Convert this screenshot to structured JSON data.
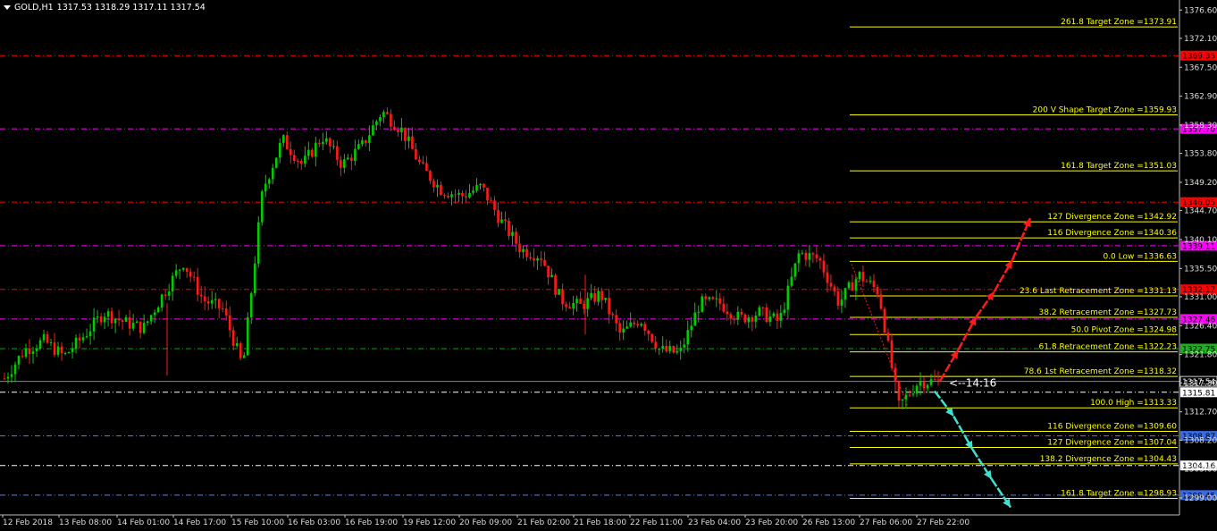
{
  "header": {
    "symbol": "GOLD,H1",
    "ohlc": "1317.53 1318.29 1317.11 1317.54"
  },
  "countdown": "<--14:16",
  "colors": {
    "background": "#000000",
    "bull": "#00cc00",
    "bear": "#ff1a1a",
    "fib": "#ffff00",
    "red_level": "#ff0000",
    "magenta_level": "#ff00ff",
    "green_level": "#00aa00",
    "blue_level": "#4a7fff",
    "white_level": "#ffffff",
    "cyan_arrow": "#40e0d0",
    "red_arrow": "#ff1a1a"
  },
  "chart_data": {
    "type": "candlestick",
    "ylim": [
      1296.3,
      1378.2
    ],
    "y_ticks": [
      "1376.60",
      "1372.10",
      "1367.50",
      "1362.90",
      "1358.30",
      "1353.80",
      "1349.20",
      "1344.70",
      "1340.10",
      "1335.50",
      "1331.00",
      "1326.40",
      "1321.80",
      "1317.30",
      "1312.70",
      "1308.20",
      "1303.60",
      "1299.00"
    ],
    "x_ticks": [
      "12 Feb 2018",
      "13 Feb 08:00",
      "14 Feb 01:00",
      "14 Feb 17:00",
      "15 Feb 10:00",
      "16 Feb 03:00",
      "16 Feb 19:00",
      "19 Feb 12:00",
      "20 Feb 09:00",
      "21 Feb 02:00",
      "21 Feb 18:00",
      "22 Feb 11:00",
      "23 Feb 04:00",
      "23 Feb 20:00",
      "26 Feb 13:00",
      "27 Feb 06:00",
      "27 Feb 22:00"
    ],
    "price_path": [
      1318.0,
      1322.5,
      1324.0,
      1321.5,
      1324.8,
      1328.5,
      1327.0,
      1326.0,
      1331.5,
      1336.5,
      1330.5,
      1329.0,
      1319.8,
      1348.0,
      1356.0,
      1352.0,
      1356.5,
      1352.0,
      1355.0,
      1360.5,
      1357.5,
      1351.5,
      1348.0,
      1347.0,
      1348.5,
      1343.0,
      1338.5,
      1337.5,
      1330.5,
      1329.5,
      1331.5,
      1325.0,
      1327.5,
      1322.5,
      1322.0,
      1330.0,
      1330.0,
      1327.5,
      1328.5,
      1327.0,
      1338.0,
      1337.0,
      1330.0,
      1334.5,
      1331.8,
      1313.5,
      1317.5,
      1317.54
    ],
    "current_price": 1317.54,
    "horizontal_levels": [
      {
        "price": 1369.35,
        "style": "red",
        "label": "1369.35"
      },
      {
        "price": 1357.7,
        "style": "magenta",
        "label": "1357.70"
      },
      {
        "price": 1346.05,
        "style": "red",
        "label": "1346.05"
      },
      {
        "price": 1339.11,
        "style": "magenta",
        "label": "1339.11"
      },
      {
        "price": 1332.17,
        "style": "red",
        "label": "1332.17"
      },
      {
        "price": 1327.46,
        "style": "magenta",
        "label": "1327.46"
      },
      {
        "price": 1322.75,
        "style": "green",
        "label": "1322.75"
      },
      {
        "price": 1315.81,
        "style": "white",
        "label": "1315.81"
      },
      {
        "price": 1308.87,
        "style": "blue",
        "label": "1308.87"
      },
      {
        "price": 1304.16,
        "style": "white",
        "label": "1304.16"
      },
      {
        "price": 1299.45,
        "style": "blue",
        "label": "1299.45"
      }
    ],
    "fib_levels": [
      {
        "price": 1373.91,
        "label": "261.8 Target Zone =1373.91"
      },
      {
        "price": 1359.93,
        "label": "200  V Shape Target Zone =1359.93"
      },
      {
        "price": 1351.03,
        "label": "161.8 Target Zone =1351.03"
      },
      {
        "price": 1342.92,
        "label": "127 Divergence Zone =1342.92"
      },
      {
        "price": 1340.36,
        "label": "116 Divergence Zone =1340.36"
      },
      {
        "price": 1336.63,
        "label": "0.0 Low =1336.63"
      },
      {
        "price": 1331.13,
        "label": "23.6 Last Retracement Zone =1331.13"
      },
      {
        "price": 1327.73,
        "label": "38.2 Retracement Zone =1327.73"
      },
      {
        "price": 1324.98,
        "label": "50.0 Pivot Zone =1324.98"
      },
      {
        "price": 1322.23,
        "label": "61.8 Retracement Zone =1322.23"
      },
      {
        "price": 1318.32,
        "label": "78.6 1st Retracement Zone =1318.32"
      },
      {
        "price": 1313.33,
        "label": "100.0 High =1313.33"
      },
      {
        "price": 1309.6,
        "label": "116 Divergence Zone =1309.60"
      },
      {
        "price": 1307.04,
        "label": "127 Divergence Zone =1307.04"
      },
      {
        "price": 1304.43,
        "label": "138.2 Divergence Zone =1304.43"
      },
      {
        "price": 1298.93,
        "label": "161.8 Target Zone =1298.93"
      }
    ],
    "up_arrow_prices": [
      1317.6,
      1322.5,
      1327.8,
      1331.8,
      1336.8,
      1343.5
    ],
    "down_arrow_prices": [
      1316.0,
      1312.0,
      1306.7,
      1302.0,
      1297.5
    ]
  }
}
